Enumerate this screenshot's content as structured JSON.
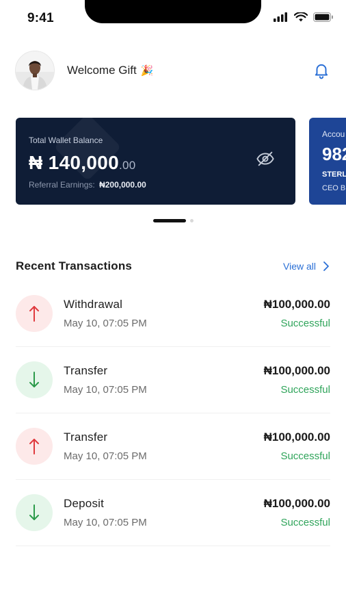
{
  "status_bar": {
    "time": "9:41"
  },
  "header": {
    "greeting": "Welcome Gift",
    "greeting_emoji": "🎉",
    "notification_icon": "bell-icon"
  },
  "wallet_card": {
    "label": "Total Wallet Balance",
    "currency_symbol": "₦",
    "amount_main": "140,000",
    "amount_cents": ".00",
    "referral_label": "Referral Earnings:",
    "referral_value": "₦200,000.00",
    "visibility_icon": "eye-off-icon"
  },
  "account_card": {
    "label": "Accou",
    "number": "982",
    "bank": "STERL",
    "name": "CEO B"
  },
  "recent": {
    "title": "Recent Transactions",
    "view_all": "View all"
  },
  "transactions": [
    {
      "title": "Withdrawal",
      "date": "May 10, 07:05 PM",
      "amount": "₦100,000.00",
      "status": "Successful",
      "direction": "out"
    },
    {
      "title": "Transfer",
      "date": "May 10, 07:05 PM",
      "amount": "₦100,000.00",
      "status": "Successful",
      "direction": "in"
    },
    {
      "title": "Transfer",
      "date": "May 10, 07:05 PM",
      "amount": "₦100,000.00",
      "status": "Successful",
      "direction": "out"
    },
    {
      "title": "Deposit",
      "date": "May 10, 07:05 PM",
      "amount": "₦100,000.00",
      "status": "Successful",
      "direction": "in"
    }
  ],
  "colors": {
    "wallet_bg": "#0f1d36",
    "account_bg": "#1e4596",
    "accent_blue": "#2a6fd6",
    "success_green": "#2fa45a",
    "outgoing_red": "#e0393e",
    "incoming_green": "#2b9a4a"
  }
}
